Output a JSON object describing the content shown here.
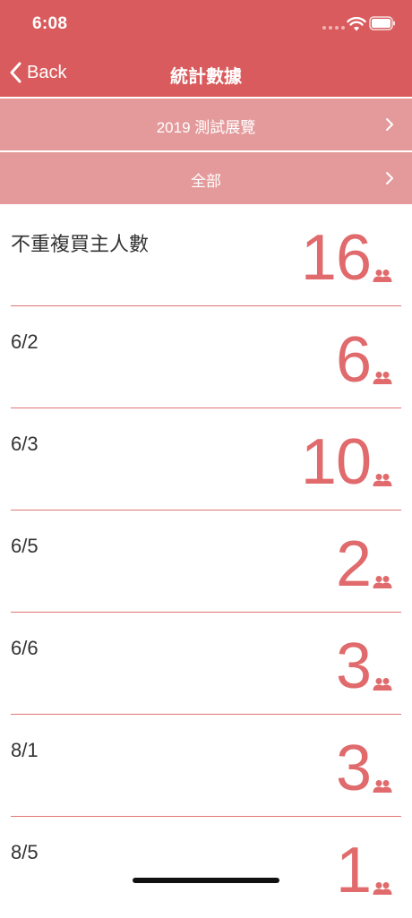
{
  "status_bar": {
    "time": "6:08"
  },
  "nav": {
    "back_label": "Back",
    "title": "統計數據"
  },
  "selectors": {
    "exhibition": "2019 測試展覽",
    "scope": "全部"
  },
  "rows": [
    {
      "label": "不重複買主人數",
      "value": "16"
    },
    {
      "label": "6/2",
      "value": "6"
    },
    {
      "label": "6/3",
      "value": "10"
    },
    {
      "label": "6/5",
      "value": "2"
    },
    {
      "label": "6/6",
      "value": "3"
    },
    {
      "label": "8/1",
      "value": "3"
    },
    {
      "label": "8/5",
      "value": "1"
    }
  ],
  "icons": {
    "back": "chevron-left-icon",
    "selector": "chevron-right-icon",
    "people": "people-icon",
    "wifi": "wifi-icon",
    "battery": "battery-icon"
  },
  "colors": {
    "header": "#d95b5d",
    "selector_bg": "#e49a9b",
    "value_red": "#e06a6c",
    "divider": "#e37474"
  }
}
